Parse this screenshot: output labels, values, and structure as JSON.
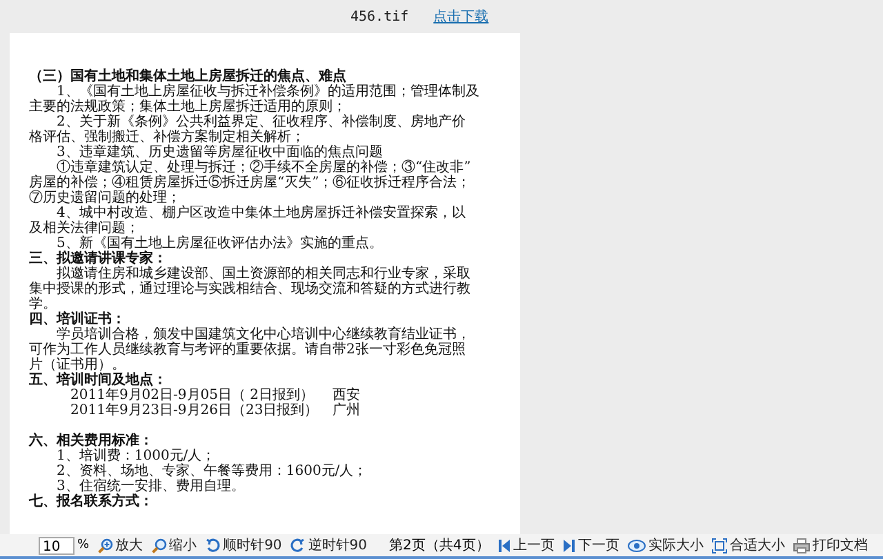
{
  "header": {
    "filename": "456.tif",
    "download_link": "点击下载"
  },
  "document": {
    "blocks": [
      {
        "kind": "heading",
        "lines": [
          "（三）国有土地和集体土地上房屋拆迁的焦点、难点"
        ]
      },
      {
        "kind": "para",
        "lines": [
          "　　1、《国有土地上房屋征收与拆迁补偿条例》的适用范围；管理体制及",
          "主要的法规政策；集体土地上房屋拆迁适用的原则；"
        ]
      },
      {
        "kind": "para",
        "lines": [
          "　　2、关于新《条例》公共利益界定、征收程序、补偿制度、房地产价",
          "格评估、强制搬迁、补偿方案制定相关解析；"
        ]
      },
      {
        "kind": "para",
        "lines": [
          "　　3、违章建筑、历史遗留等房屋征收中面临的焦点问题"
        ]
      },
      {
        "kind": "para",
        "lines": [
          "　　①违章建筑认定、处理与拆迁；②手续不全房屋的补偿；③“住改非”",
          "房屋的补偿；④租赁房屋拆迁⑤拆迁房屋“灭失”；⑥征收拆迁程序合法；",
          "⑦历史遗留问题的处理；"
        ]
      },
      {
        "kind": "para",
        "lines": [
          "　　4、城中村改造、棚户区改造中集体土地房屋拆迁补偿安置探索，以",
          "及相关法律问题；"
        ]
      },
      {
        "kind": "para",
        "lines": [
          "　　5、新《国有土地上房屋征收评估办法》实施的重点。"
        ]
      },
      {
        "kind": "heading",
        "lines": [
          "三、拟邀请讲课专家："
        ]
      },
      {
        "kind": "para",
        "lines": [
          "　　拟邀请住房和城乡建设部、国土资源部的相关同志和行业专家，采取",
          "集中授课的形式，通过理论与实践相结合、现场交流和答疑的方式进行教",
          "学。"
        ]
      },
      {
        "kind": "heading",
        "lines": [
          "四、培训证书："
        ]
      },
      {
        "kind": "para",
        "lines": [
          "　　学员培训合格，颁发中国建筑文化中心培训中心继续教育结业证书，",
          "可作为工作人员继续教育与考评的重要依据。请自带2张一寸彩色免冠照",
          "片（证书用）。"
        ]
      },
      {
        "kind": "heading",
        "lines": [
          "五、培训时间及地点："
        ]
      },
      {
        "kind": "schedule",
        "rows": [
          {
            "date": "2011年9月02日-9月05日（ 2日报到）",
            "city": "西安"
          },
          {
            "date": "2011年9月23日-9月26日（23日报到）",
            "city": "广州"
          }
        ]
      },
      {
        "kind": "heading",
        "lines": [
          "六、相关费用标准："
        ]
      },
      {
        "kind": "para",
        "lines": [
          "　　1、培训费：1000元/人；"
        ]
      },
      {
        "kind": "para",
        "lines": [
          "　　2、资料、场地、专家、午餐等费用：1600元/人；"
        ]
      },
      {
        "kind": "para",
        "lines": [
          "　　3、住宿统一安排、费用自理。"
        ]
      },
      {
        "kind": "heading",
        "lines": [
          "七、报名联系方式："
        ]
      }
    ]
  },
  "toolbar": {
    "zoom_value": "10",
    "zoom_unit": "%",
    "page_info": "第2页（共4页）",
    "buttons": [
      {
        "kind": "zoom-in",
        "label": "放大"
      },
      {
        "kind": "zoom-out",
        "label": "缩小"
      },
      {
        "kind": "rotate-cw",
        "label": "顺时针90"
      },
      {
        "kind": "rotate-ccw",
        "label": "逆时针90"
      },
      {
        "kind": "page-info"
      },
      {
        "kind": "prev",
        "label": "上一页"
      },
      {
        "kind": "next",
        "label": "下一页"
      },
      {
        "kind": "actual-size",
        "label": "实际大小"
      },
      {
        "kind": "fit-size",
        "label": "合适大小"
      },
      {
        "kind": "print",
        "label": "打印文档"
      }
    ]
  }
}
